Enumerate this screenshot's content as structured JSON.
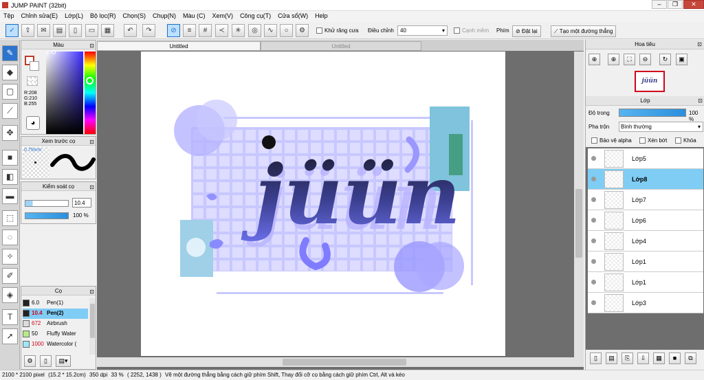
{
  "window": {
    "title": "JUMP PAINT (32bit)",
    "minimize": "–",
    "maximize": "❐",
    "close": "✕"
  },
  "menu": [
    "Tệp",
    "Chỉnh sửa(E)",
    "Lớp(L)",
    "Bộ lọc(R)",
    "Chọn(S)",
    "Chụp(N)",
    "Màu (C)",
    "Xem(V)",
    "Công cụ(T)",
    "Cửa sổ(W)",
    "Help"
  ],
  "toolbar": {
    "antialias_label": "Khử răng cưa",
    "adjust_label": "Điều chỉnh",
    "adjust_value": "40",
    "edge_label": "Cạnh mềm",
    "key_label": "Phím",
    "reset_label": "Đặt lại",
    "straight_line_label": "Tạo một đường thẳng"
  },
  "color_panel": {
    "title": "Màu",
    "r": "R:208",
    "g": "G:210",
    "b": "B:255"
  },
  "preview_panel": {
    "title": "Xem trước cọ",
    "size": "0.75mm"
  },
  "brush_control": {
    "title": "Kiểm soát cọ",
    "size_value": "10.4",
    "opacity_value": "100 %"
  },
  "brush_panel": {
    "title": "Cọ",
    "brushes": [
      {
        "size": "6.0",
        "name": "Pen(1)",
        "color": "#222222"
      },
      {
        "size": "10.4",
        "name": "Pen(2)",
        "color": "#222222"
      },
      {
        "size": "672",
        "name": "Airbrush",
        "color": "#dddddd"
      },
      {
        "size": "50",
        "name": "Fluffy Water",
        "color": "#b8e986"
      },
      {
        "size": "1000",
        "name": "Watercolor (",
        "color": "#9fe6f5"
      }
    ]
  },
  "tabs": {
    "active": "Untitled",
    "inactive": "Untitled"
  },
  "artwork": {
    "text": "jüün"
  },
  "navigator": {
    "title": "Hoa tiêu",
    "thumb_text": "jüün"
  },
  "layers_panel": {
    "title": "Lớp",
    "opacity_label": "Độ trong",
    "opacity_value": "100 %",
    "blend_label": "Pha trộn",
    "blend_value": "Bình thường",
    "protect_alpha": "Bảo vệ alpha",
    "clip": "Xén bớt",
    "lock": "Khóa",
    "layers": [
      {
        "name": "Lớp5",
        "selected": false
      },
      {
        "name": "Lớp8",
        "selected": true
      },
      {
        "name": "Lớp7",
        "selected": false
      },
      {
        "name": "Lớp6",
        "selected": false
      },
      {
        "name": "Lớp4",
        "selected": false
      },
      {
        "name": "Lớp1",
        "selected": false
      },
      {
        "name": "Lớp1",
        "selected": false
      },
      {
        "name": "Lớp3",
        "selected": false
      }
    ]
  },
  "status": {
    "size": "2100 * 2100 pixel",
    "cm": "(15.2 * 15.2cm)",
    "dpi": "350 dpi",
    "zoom": "33 %",
    "coords": "( 2252, 1438 )",
    "hint": "Vẽ một đường thẳng bằng cách giữ phím Shift, Thay đổi cỡ cọ bằng cách giữ phím Ctrl, Alt và kéo"
  }
}
